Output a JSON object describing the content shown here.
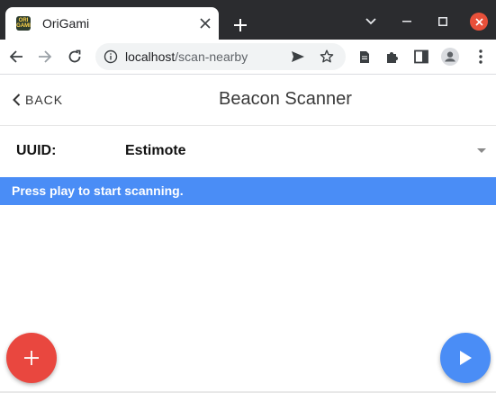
{
  "browser": {
    "tab_title": "OriGami",
    "favicon_text": "ORI GAMI",
    "url_host": "localhost",
    "url_path": "/scan-nearby"
  },
  "icons": {
    "tab_close": "close-icon",
    "new_tab": "plus-icon",
    "back": "arrow-left-icon",
    "forward": "arrow-right-icon",
    "reload": "reload-icon",
    "site_info": "info-icon",
    "send": "send-icon",
    "bookmark": "star-icon",
    "reading_list": "document-icon",
    "extensions": "puzzle-icon",
    "side_panel": "side-panel-icon",
    "profile": "profile-icon",
    "menu": "more-vert-icon",
    "add_fab": "plus-icon",
    "play_fab": "play-icon"
  },
  "app": {
    "back_label": "BACK",
    "title": "Beacon Scanner",
    "uuid_label": "UUID:",
    "uuid_value": "Estimote",
    "status": "Press play to start scanning."
  },
  "colors": {
    "accent_blue": "#4a8df6",
    "fab_red": "#e9473f",
    "chrome_dark": "#2b2c2f"
  }
}
